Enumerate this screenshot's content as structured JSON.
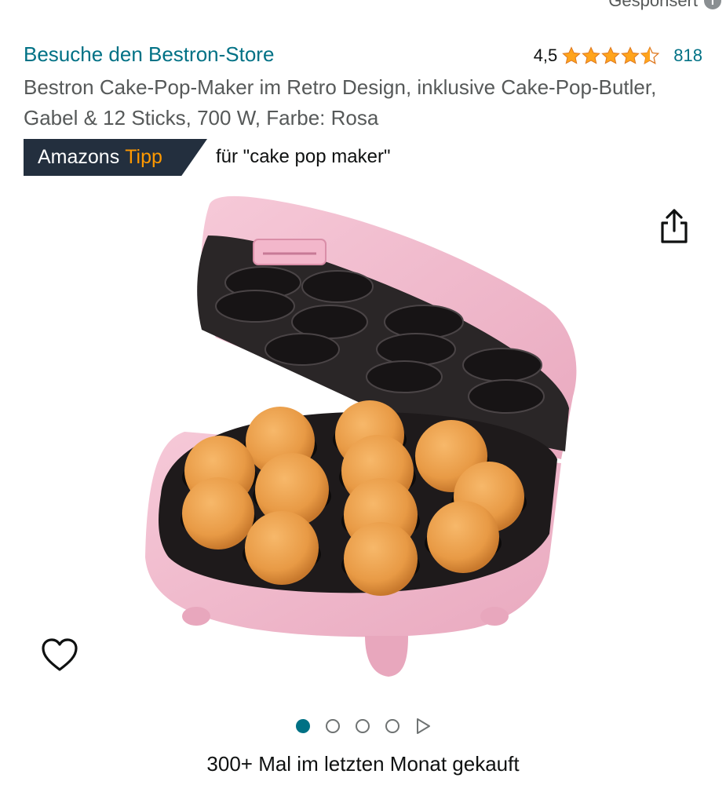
{
  "sponsored": {
    "label": "Gesponsert",
    "info_icon": "i"
  },
  "store": {
    "link_text": "Besuche den Bestron-Store"
  },
  "rating": {
    "value": "4,5",
    "stars": 4.5,
    "count": "818",
    "star_color": "#ffa41c"
  },
  "product": {
    "title": "Bestron Cake-Pop-Maker im Retro Design, inklusive Cake-Pop-Butler, Gabel & 12 Sticks, 700 W, Farbe: Rosa",
    "image_icon": "cake-pop-maker-image"
  },
  "badge": {
    "part1": "Amazons",
    "part2": "Tipp",
    "suffix": "für \"cake pop maker\""
  },
  "icons": {
    "share": "share-icon",
    "favorite": "heart-icon"
  },
  "pager": {
    "total_dots": 4,
    "active_index": 0,
    "has_video": true
  },
  "social_proof": {
    "text": "300+ Mal im letzten Monat gekauft"
  },
  "colors": {
    "link": "#007185",
    "badge_bg": "#232f3e",
    "badge_accent": "#ff9900"
  }
}
